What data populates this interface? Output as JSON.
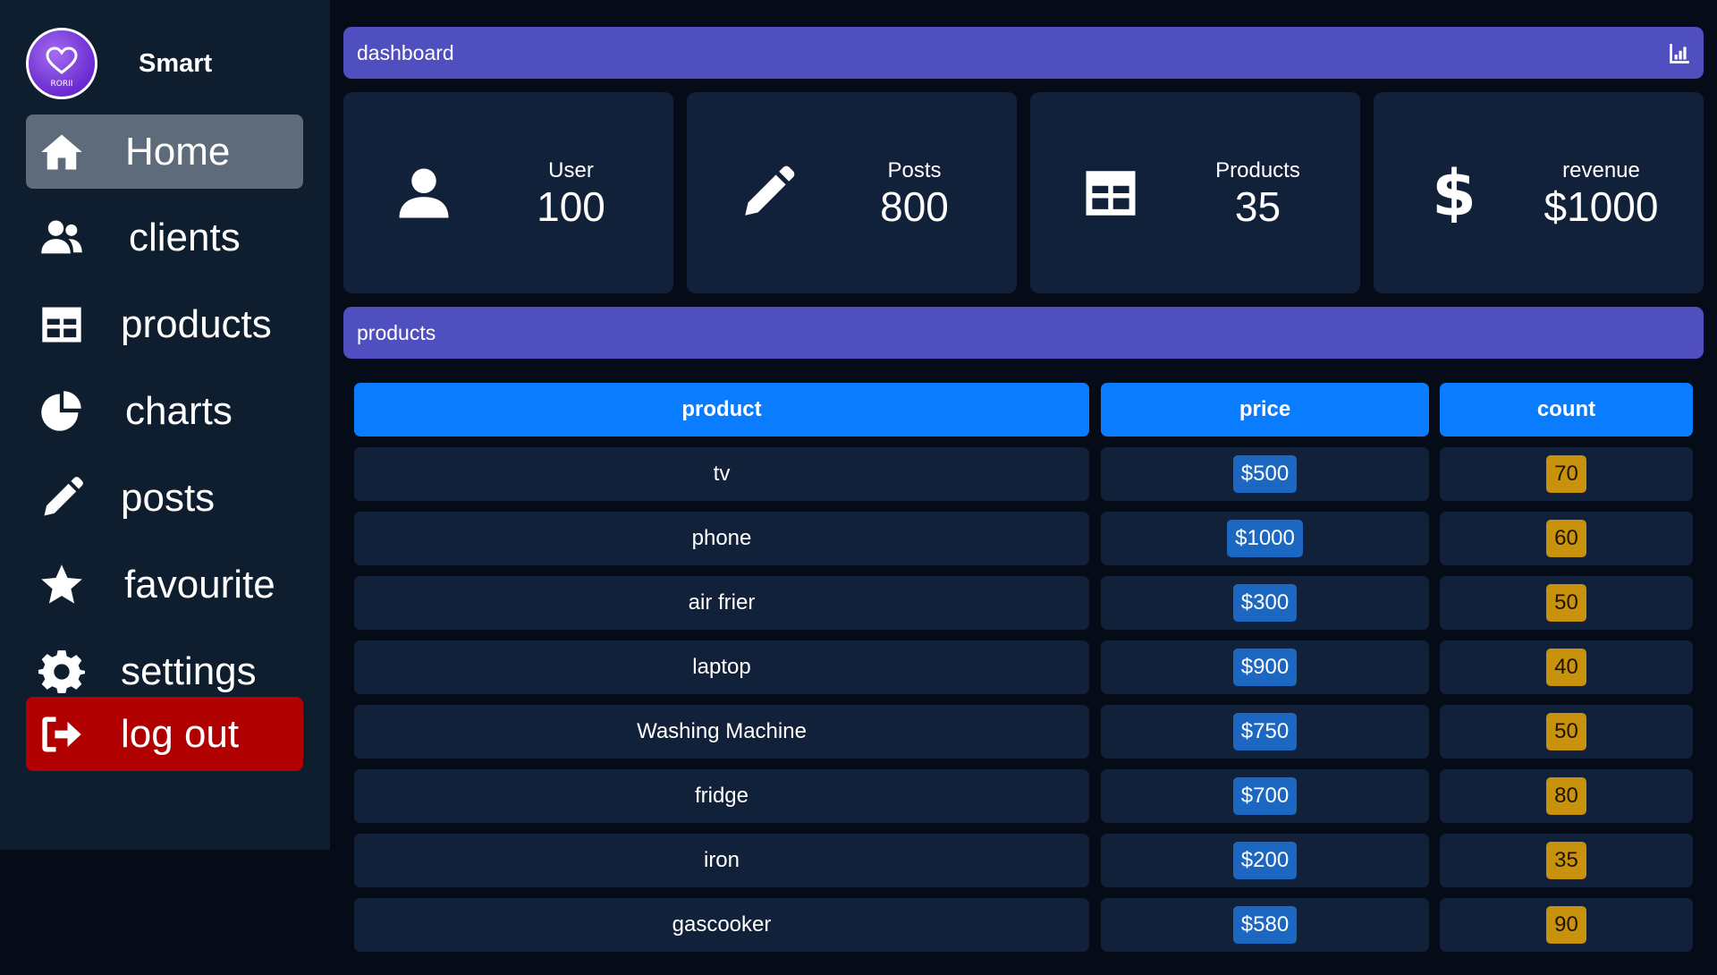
{
  "brand": {
    "name": "Smart",
    "logo_text": "RORII"
  },
  "sidebar": {
    "items": [
      {
        "label": "Home",
        "icon": "home-icon",
        "active": true
      },
      {
        "label": "clients",
        "icon": "users-icon"
      },
      {
        "label": "products",
        "icon": "table-icon"
      },
      {
        "label": "charts",
        "icon": "pie-chart-icon"
      },
      {
        "label": "posts",
        "icon": "pencil-icon"
      },
      {
        "label": "favourite",
        "icon": "star-icon"
      },
      {
        "label": "settings",
        "icon": "gear-icon"
      }
    ],
    "logout": {
      "label": "log out",
      "icon": "sign-out-icon"
    }
  },
  "header": {
    "title": "dashboard",
    "icon": "bar-chart-icon"
  },
  "stats": [
    {
      "label": "User",
      "value": "100",
      "icon": "user-icon"
    },
    {
      "label": "Posts",
      "value": "800",
      "icon": "pencil-icon"
    },
    {
      "label": "Products",
      "value": "35",
      "icon": "table-icon"
    },
    {
      "label": "revenue",
      "value": "$1000",
      "icon": "dollar-icon"
    }
  ],
  "products_section": {
    "title": "products"
  },
  "table": {
    "headers": [
      "product",
      "price",
      "count"
    ],
    "rows": [
      {
        "product": "tv",
        "price": "$500",
        "count": "70"
      },
      {
        "product": "phone",
        "price": "$1000",
        "count": "60"
      },
      {
        "product": "air frier",
        "price": "$300",
        "count": "50"
      },
      {
        "product": "laptop",
        "price": "$900",
        "count": "40"
      },
      {
        "product": "Washing Machine",
        "price": "$750",
        "count": "50"
      },
      {
        "product": "fridge",
        "price": "$700",
        "count": "80"
      },
      {
        "product": "iron",
        "price": "$200",
        "count": "35"
      },
      {
        "product": "gascooker",
        "price": "$580",
        "count": "90"
      }
    ]
  },
  "colors": {
    "background": "#050b17",
    "sidebar": "#0f1e2f",
    "card": "#12213a",
    "accent_bar": "#4f4fbf",
    "table_header": "#0a7cff",
    "price_chip": "#1c67c2",
    "count_chip": "#c8920c",
    "logout": "#b00000",
    "active_nav": "#5e6b7a"
  }
}
